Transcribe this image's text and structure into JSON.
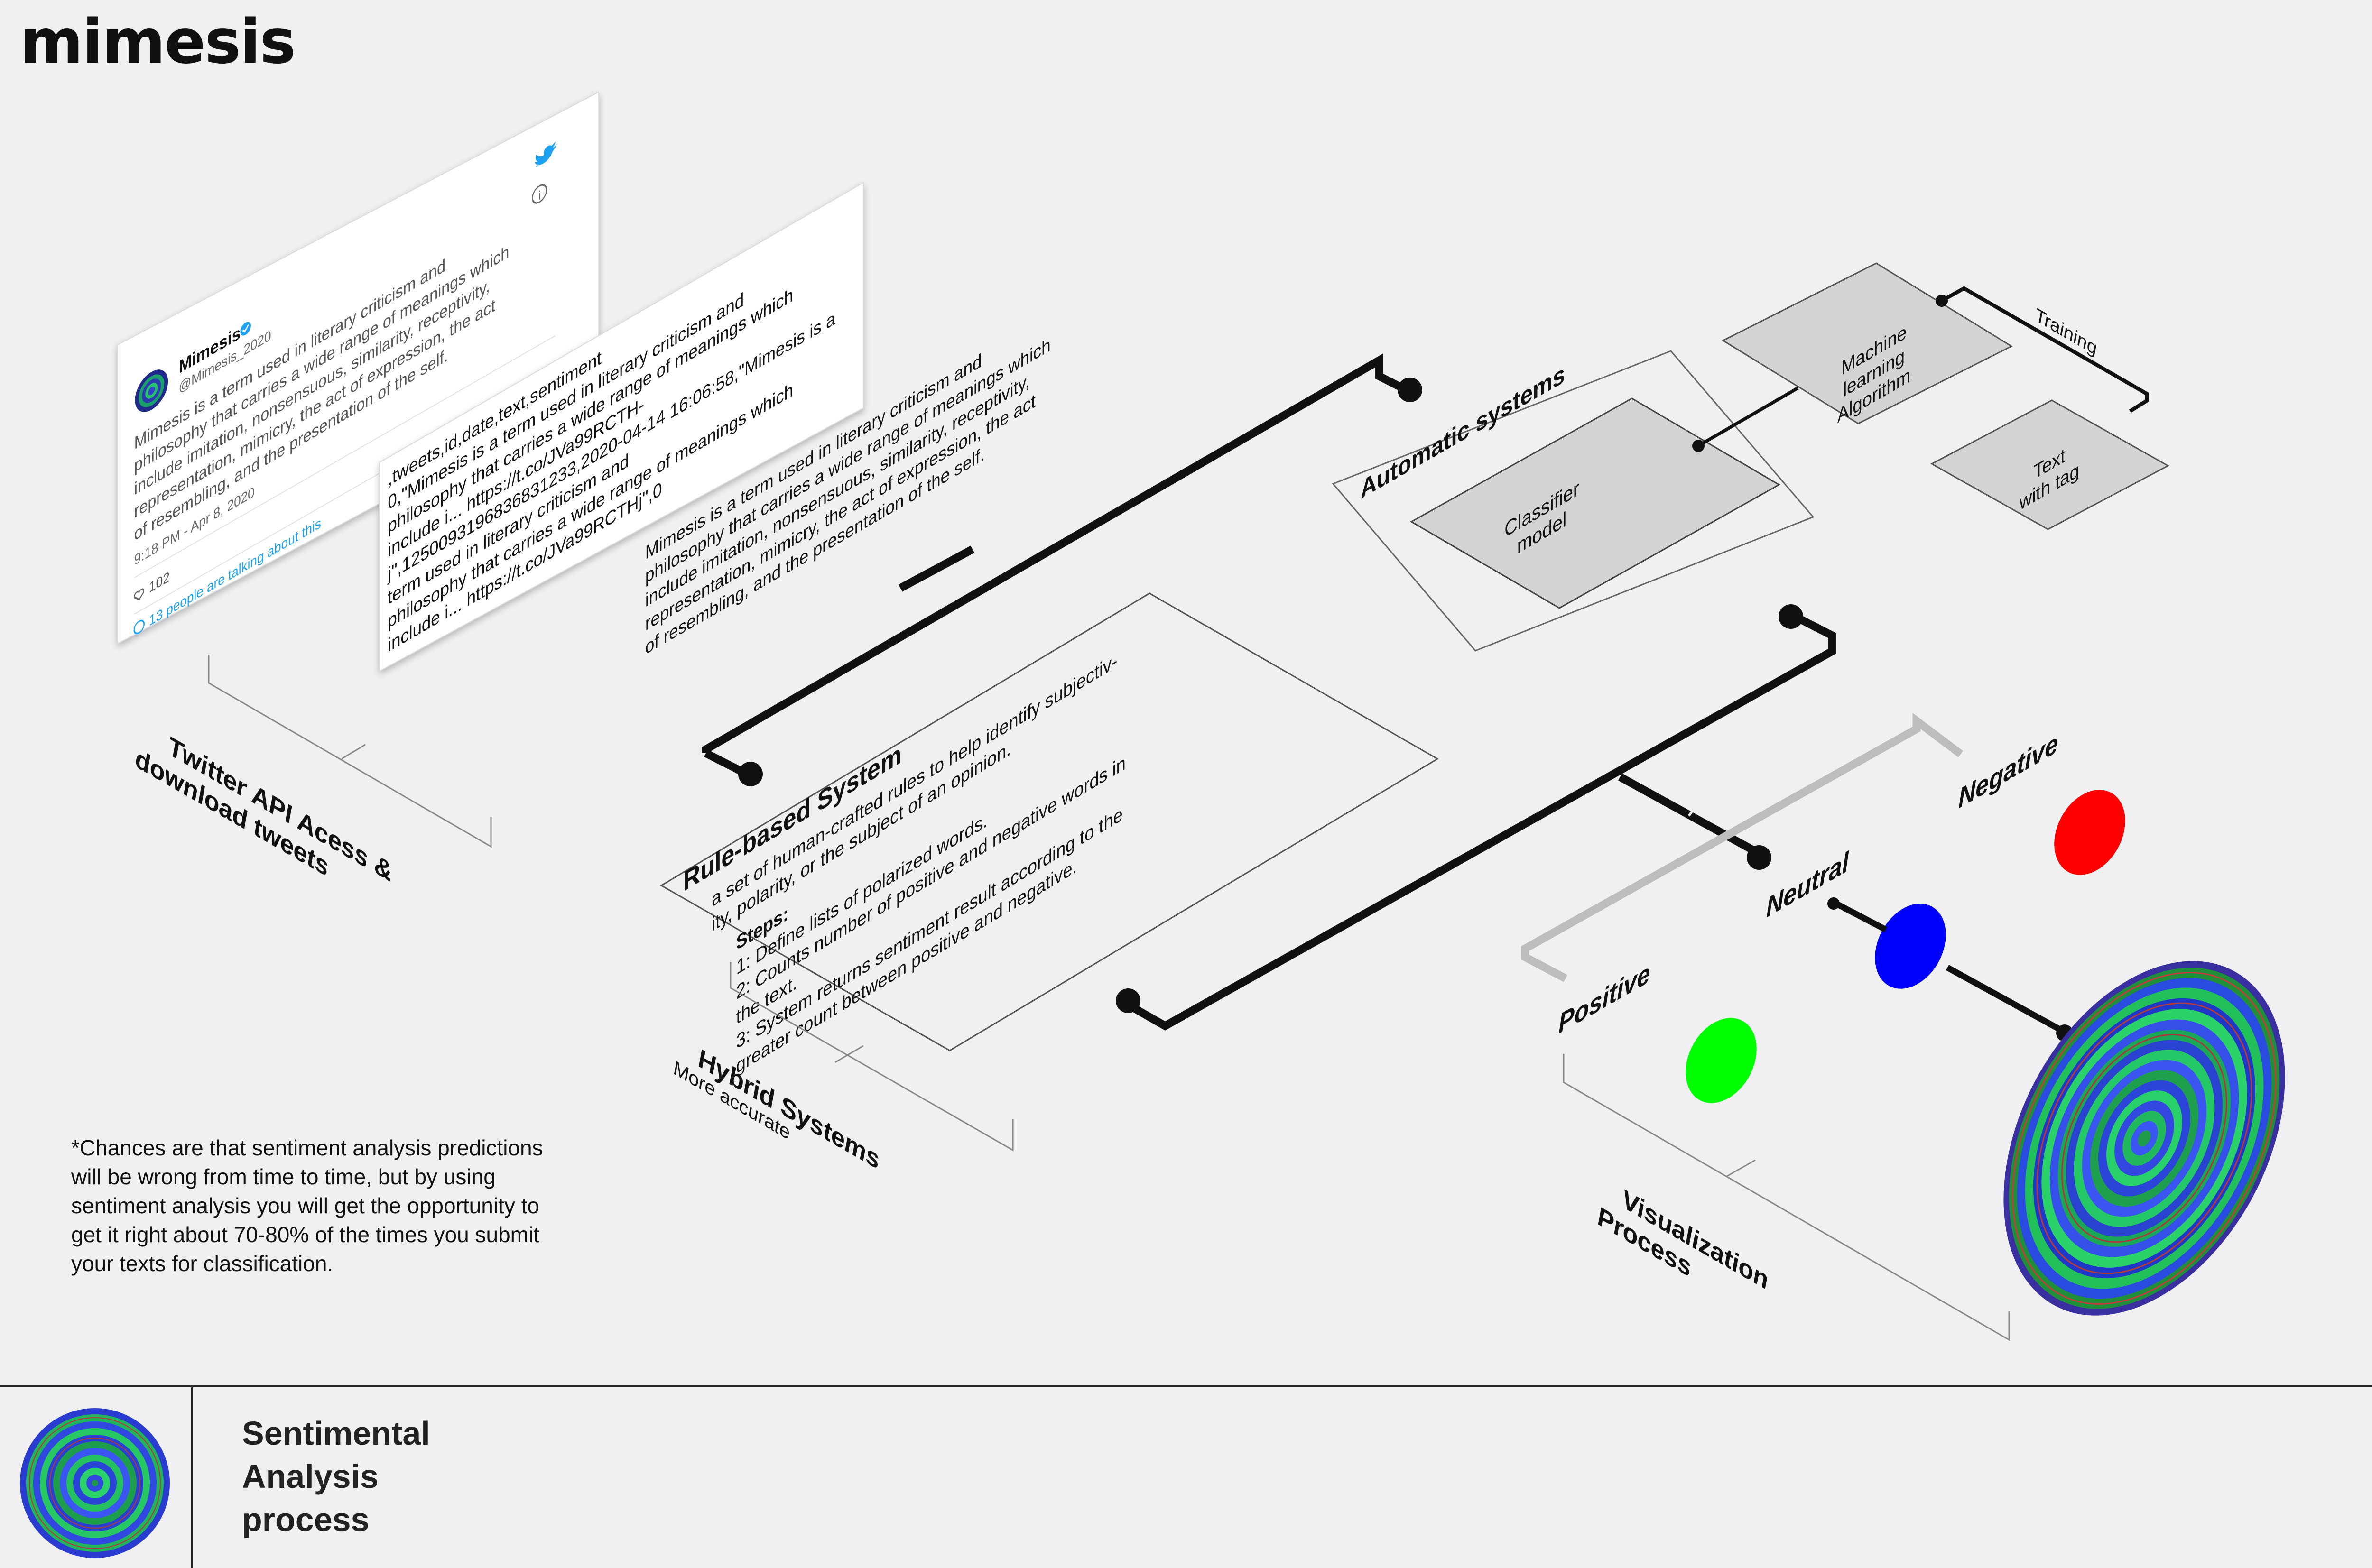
{
  "header": {
    "title": "mimesis"
  },
  "tweet_card": {
    "name": "Mimesis",
    "handle": "@Mimesis_2020",
    "text_lines": [
      "Mimesis is a term used in literary criticism and",
      "philosophy that carries a wide range of meanings which",
      "include imitation, nonsensuous, similarity, receptivity,",
      "representation, mimicry, the act of expression, the act",
      "of resembling, and the presentation of the self."
    ],
    "time": "9:18 PM - Apr 8, 2020",
    "likes": "102",
    "talking": "13 people are talking about this"
  },
  "csv_card": {
    "lines": [
      ",tweets,id,date,text,sentiment",
      "0,\"Mimesis is a term used in literary criticism and",
      "philosophy that carries a wide range of meanings which",
      "include i... https://t.co/JVa99RCTH-",
      "j\",1250093196836831233,2020-04-14 16:06:58,\"Mimesis is a",
      "term used in literary criticism and",
      "philosophy that carries a wide range of meanings which",
      "include i... https://t.co/JVa99RCTHj\",0"
    ]
  },
  "plain_text": {
    "lines": [
      "Mimesis is a term used in literary criticism and",
      "philosophy that carries a wide range of meanings which",
      "include imitation, nonsensuous, similarity, receptivity,",
      "representation, mimicry, the act of expression, the act",
      "of resembling, and the presentation of the self."
    ]
  },
  "twitter_label": {
    "lines": [
      "Twitter API Acess &",
      "download tweets"
    ]
  },
  "rule_based": {
    "title": "Rule-based System",
    "description": [
      "a set of human-crafted rules to help identify subjectiv-",
      "ity, polarity, or the subject of an opinion."
    ],
    "steps_label": "Steps:",
    "steps": [
      "1: Define lists of polarized words.",
      "2: Counts number of positive and negative words in",
      "the text.",
      "3: System returns sentiment result according to the",
      "greater count between positive and negative."
    ]
  },
  "hybrid": {
    "title": "Hybrid Systems",
    "subtitle": "More accurate"
  },
  "automatic": {
    "title": "Automatic systems",
    "classifier": [
      "Classifier",
      "model"
    ],
    "ml": [
      "Machine",
      "learning",
      "Algorithm"
    ],
    "text_tag": [
      "Text",
      "with tag"
    ],
    "training": "Training"
  },
  "sentiments": {
    "positive": "Positive",
    "neutral": "Neutral",
    "negative": "Negative",
    "colors": {
      "positive": "#00ff00",
      "neutral": "#0000ff",
      "negative": "#ff0000"
    }
  },
  "visualization": {
    "lines": [
      "Visualization",
      "Process"
    ]
  },
  "footnote": "*Chances are that sentiment analysis predictions will be wrong from time to time, but by using sentiment analysis you will get the opportunity to get it right about 70-80% of the times you submit your texts for classification.",
  "footer": {
    "title": "Sentimental\nAnalysis\nprocess"
  }
}
